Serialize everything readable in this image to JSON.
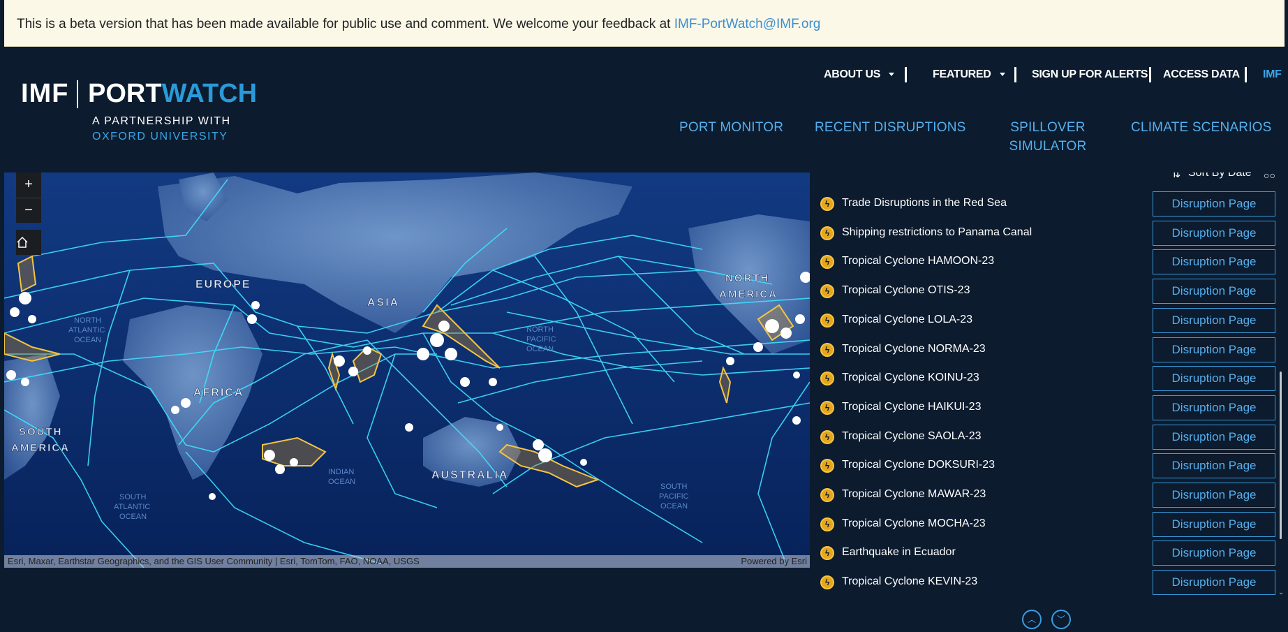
{
  "banner": {
    "text": "This is a beta version that has been made available for public use and comment. We welcome your feedback at ",
    "link": "IMF-PortWatch@IMF.org"
  },
  "logo": {
    "imf": "IMF",
    "port": "PORT",
    "watch": "WATCH",
    "subtitle_1": "A PARTNERSHIP WITH",
    "subtitle_2": "OXFORD UNIVERSITY"
  },
  "top_nav": {
    "about_us": "ABOUT US",
    "featured": "FEATURED",
    "sign_up": "SIGN UP FOR ALERTS",
    "access_data": "ACCESS DATA",
    "imf": "IMF"
  },
  "main_nav": {
    "port_monitor": "PORT MONITOR",
    "recent_disruptions": "RECENT DISRUPTIONS",
    "spillover_line1": "SPILLOVER",
    "spillover_line2": "SIMULATOR",
    "climate_scenarios": "CLIMATE SCENARIOS"
  },
  "map": {
    "zoom_in": "+",
    "zoom_out": "−",
    "labels": {
      "europe": "EUROPE",
      "asia": "ASIA",
      "africa": "AFRICA",
      "australia": "AUSTRALIA",
      "north_america_1": "NORTH",
      "north_america_2": "AMERICA",
      "south_america_1": "SOUTH",
      "south_america_2": "AMERICA",
      "indian_ocean_1": "INDIAN",
      "indian_ocean_2": "OCEAN",
      "south_atlantic_1": "SOUTH",
      "south_atlantic_2": "ATLANTIC",
      "south_atlantic_3": "OCEAN",
      "south_pacific_1": "SOUTH",
      "south_pacific_2": "PACIFIC",
      "south_pacific_3": "OCEAN",
      "north_atlantic_1": "NORTH",
      "north_atlantic_2": "ATLANTIC",
      "north_atlantic_3": "OCEAN",
      "north_pacific_1": "NORTH",
      "north_pacific_2": "PACIFIC",
      "north_pacific_3": "OCEAN"
    },
    "attribution": "Esri, Maxar, Earthstar Geographics, and the GIS User Community | Esri, TomTom, FAO, NOAA, USGS",
    "powered_by": "Powered by Esri"
  },
  "list": {
    "sort_label": "Sort By Date",
    "button_label": "Disruption Page",
    "items": [
      "Trade Disruptions in the Red Sea",
      "Shipping restrictions to Panama Canal",
      "Tropical Cyclone HAMOON-23",
      "Tropical Cyclone OTIS-23",
      "Tropical Cyclone LOLA-23",
      "Tropical Cyclone NORMA-23",
      "Tropical Cyclone KOINU-23",
      "Tropical Cyclone HAIKUI-23",
      "Tropical Cyclone SAOLA-23",
      "Tropical Cyclone DOKSURI-23",
      "Tropical Cyclone MAWAR-23",
      "Tropical Cyclone MOCHA-23",
      "Earthquake in Ecuador",
      "Tropical Cyclone KEVIN-23"
    ]
  },
  "colors": {
    "background": "#0c1b2e",
    "accent": "#3a9ee0",
    "route_line": "#3ee0ff",
    "cyclone_track": "#f4c542",
    "banner_bg": "#fbf8e8"
  },
  "icons": {
    "home": "home-icon",
    "disruption": "lightning-icon",
    "sort": "sort-icon",
    "page_up": "chevron-up-icon",
    "page_down": "chevron-down-icon"
  }
}
